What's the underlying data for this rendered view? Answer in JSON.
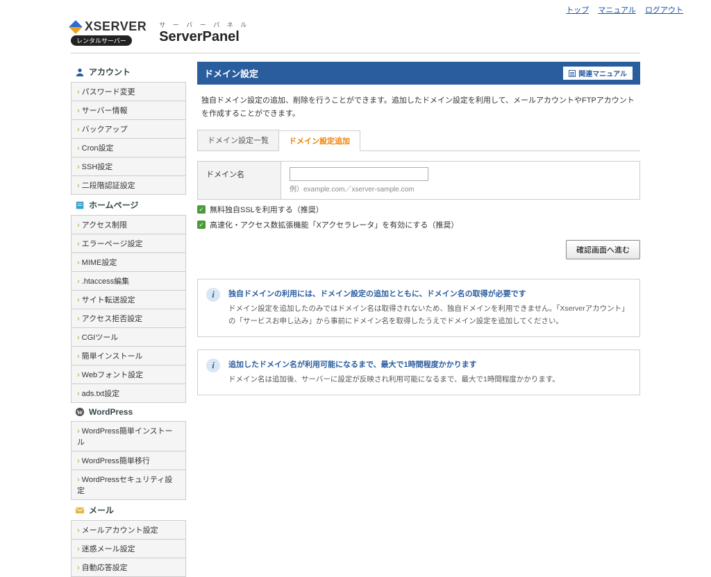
{
  "top_links": {
    "top": "トップ",
    "manual": "マニュアル",
    "logout": "ログアウト"
  },
  "header": {
    "brand": "XSERVER",
    "badge": "レンタルサーバー",
    "kana": "サ ー バ ー パ ネ ル",
    "title": "ServerPanel"
  },
  "sidebar": {
    "sections": [
      {
        "title": "アカウント",
        "icon": "user-icon",
        "items": [
          "パスワード変更",
          "サーバー情報",
          "バックアップ",
          "Cron設定",
          "SSH設定",
          "二段階認証設定"
        ]
      },
      {
        "title": "ホームページ",
        "icon": "page-icon",
        "items": [
          "アクセス制限",
          "エラーページ設定",
          "MIME設定",
          ".htaccess編集",
          "サイト転送設定",
          "アクセス拒否設定",
          "CGIツール",
          "簡単インストール",
          "Webフォント設定",
          "ads.txt設定"
        ]
      },
      {
        "title": "WordPress",
        "icon": "wp-icon",
        "items": [
          "WordPress簡単インストール",
          "WordPress簡単移行",
          "WordPressセキュリティ設定"
        ]
      },
      {
        "title": "メール",
        "icon": "mail-icon",
        "items": [
          "メールアカウント設定",
          "迷惑メール設定",
          "自動応答設定"
        ]
      }
    ]
  },
  "main": {
    "title": "ドメイン設定",
    "manual_link": "関連マニュアル",
    "description": "独自ドメイン設定の追加、削除を行うことができます。追加したドメイン設定を利用して、メールアカウントやFTPアカウントを作成することができます。",
    "tabs": [
      {
        "label": "ドメイン設定一覧",
        "active": false
      },
      {
        "label": "ドメイン設定追加",
        "active": true
      }
    ],
    "form": {
      "domain_label": "ドメイン名",
      "domain_value": "",
      "domain_hint": "例）example.com／xserver-sample.com",
      "ssl_label": "無料独自SSLを利用する（推奨）",
      "accel_label": "高速化・アクセス数拡張機能「Xアクセラレータ」を有効にする（推奨）",
      "submit_label": "確認画面へ進む"
    },
    "info": [
      {
        "title": "独自ドメインの利用には、ドメイン設定の追加とともに、ドメイン名の取得が必要です",
        "body": "ドメイン設定を追加したのみではドメイン名は取得されないため、独自ドメインを利用できません。「Xserverアカウント」の「サービスお申し込み」から事前にドメイン名を取得したうえでドメイン設定を追加してください。"
      },
      {
        "title": "追加したドメイン名が利用可能になるまで、最大で1時間程度かかります",
        "body": "ドメイン名は追加後、サーバーに設定が反映され利用可能になるまで、最大で1時間程度かかります。"
      }
    ]
  }
}
